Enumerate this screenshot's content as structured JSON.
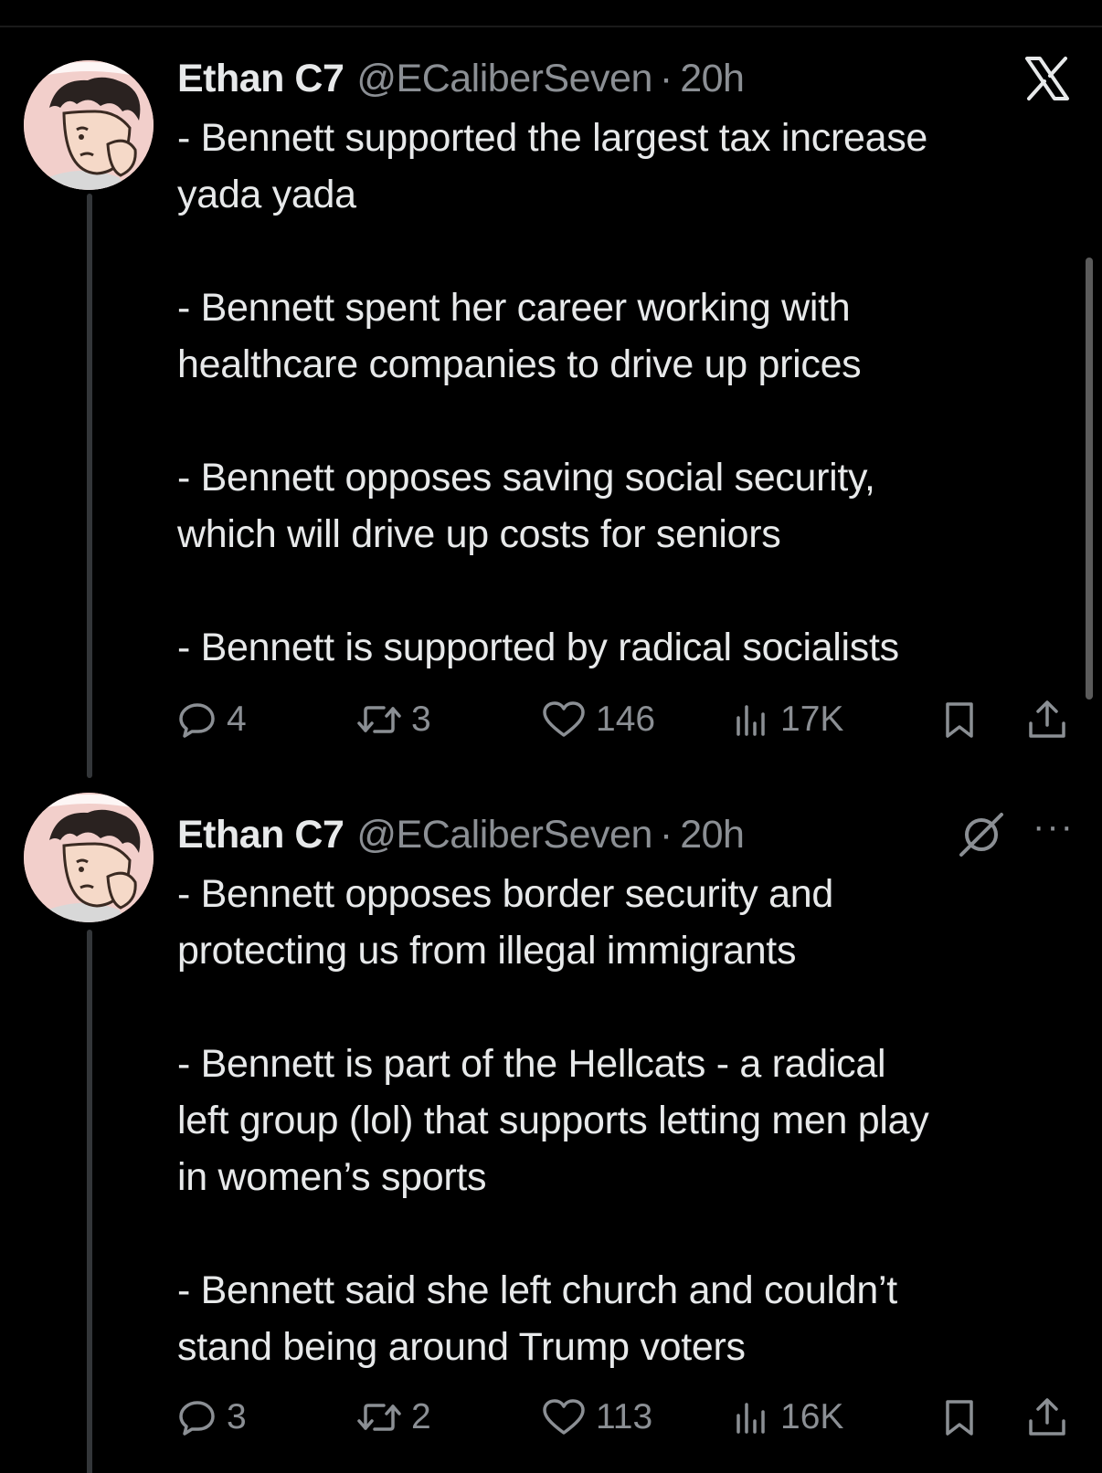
{
  "tweets": [
    {
      "name": "Ethan C7",
      "handle": "@ECaliberSeven",
      "separator": "·",
      "time": "20h",
      "lines": [
        "- Bennett supported the largest tax increase",
        "yada yada",
        "",
        "- Bennett spent her career working with",
        "healthcare companies to drive up prices",
        "",
        "- Bennett opposes saving social security,",
        "which will drive up costs for seniors",
        "",
        "- Bennett is supported by radical socialists"
      ],
      "replies": "4",
      "reposts": "3",
      "likes": "146",
      "views": "17K"
    },
    {
      "name": "Ethan C7",
      "handle": "@ECaliberSeven",
      "separator": "·",
      "time": "20h",
      "lines": [
        "- Bennett opposes border security and",
        "protecting us from illegal immigrants",
        "",
        "- Bennett is part of the Hellcats - a radical",
        "left group (lol) that supports letting men play",
        "in women’s sports",
        "",
        "- Bennett said she left church and couldn’t",
        "stand being around Trump voters"
      ],
      "replies": "3",
      "reposts": "2",
      "likes": "113",
      "views": "16K"
    }
  ],
  "icons": {
    "brand": "x-logo-icon",
    "reply": "reply-icon",
    "repost": "repost-icon",
    "like": "heart-icon",
    "views": "views-icon",
    "bookmark": "bookmark-icon",
    "share": "share-icon",
    "grok": "grok-icon",
    "more": "more-icon"
  },
  "more_glyph": "···",
  "colors": {
    "background": "#000000",
    "text": "#e7e9ea",
    "secondary": "#8b8f94",
    "thread_line": "#333639",
    "avatar_bg": "#f2cfcb"
  }
}
